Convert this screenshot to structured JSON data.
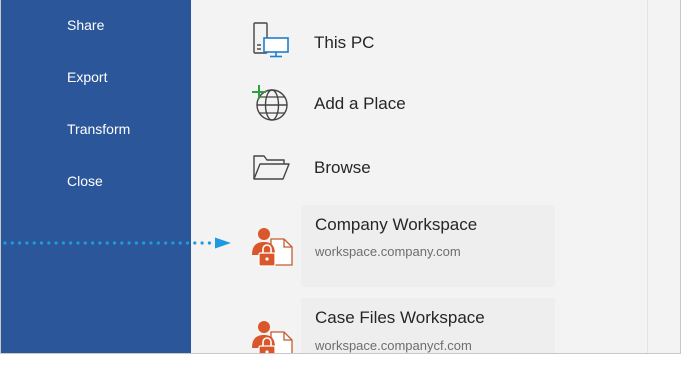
{
  "sidebar": {
    "items": [
      {
        "label": "Share"
      },
      {
        "label": "Export"
      },
      {
        "label": "Transform"
      },
      {
        "label": "Close"
      }
    ]
  },
  "locations": [
    {
      "label": "This PC",
      "icon": "this-pc-icon"
    },
    {
      "label": "Add a Place",
      "icon": "add-place-globe-icon"
    },
    {
      "label": "Browse",
      "icon": "folder-icon"
    }
  ],
  "workspaces": [
    {
      "title": "Company Workspace",
      "url": "workspace.company.com",
      "icon": "locked-workspace-icon"
    },
    {
      "title": "Case Files Workspace",
      "url": "workspace.companycf.com",
      "icon": "locked-workspace-icon"
    }
  ],
  "colors": {
    "sidebar": "#2b579a",
    "callout": "#1e9be0",
    "workspace_icon": "#d9572a",
    "add_plus": "#2e9e44"
  }
}
